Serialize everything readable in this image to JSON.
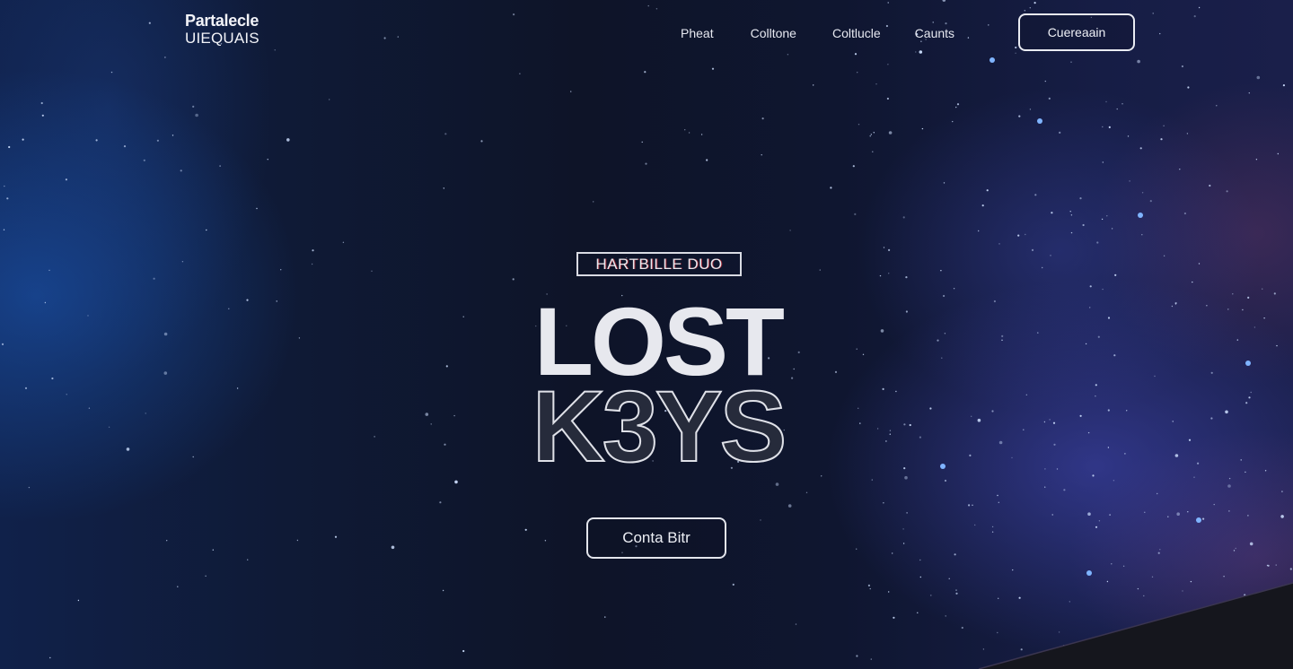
{
  "brand": {
    "line1": "Partalecle",
    "line2": "UIEQUAIS"
  },
  "nav": {
    "items": [
      "Pheat",
      "Colltone",
      "Coltlucle",
      "Caunts"
    ],
    "cta_label": "Cuereaain"
  },
  "hero": {
    "tagline": "HARTBILLE DUO",
    "title_line1": "LOST",
    "title_line2": "K3YS",
    "cta_label": "Conta Bitr"
  },
  "colors": {
    "background": "#0d1326",
    "accent_blue": "#1c5cbe",
    "nebula_violet": "#464bbe",
    "text": "#e7e8ee",
    "outline_fill": "#262b3b"
  }
}
